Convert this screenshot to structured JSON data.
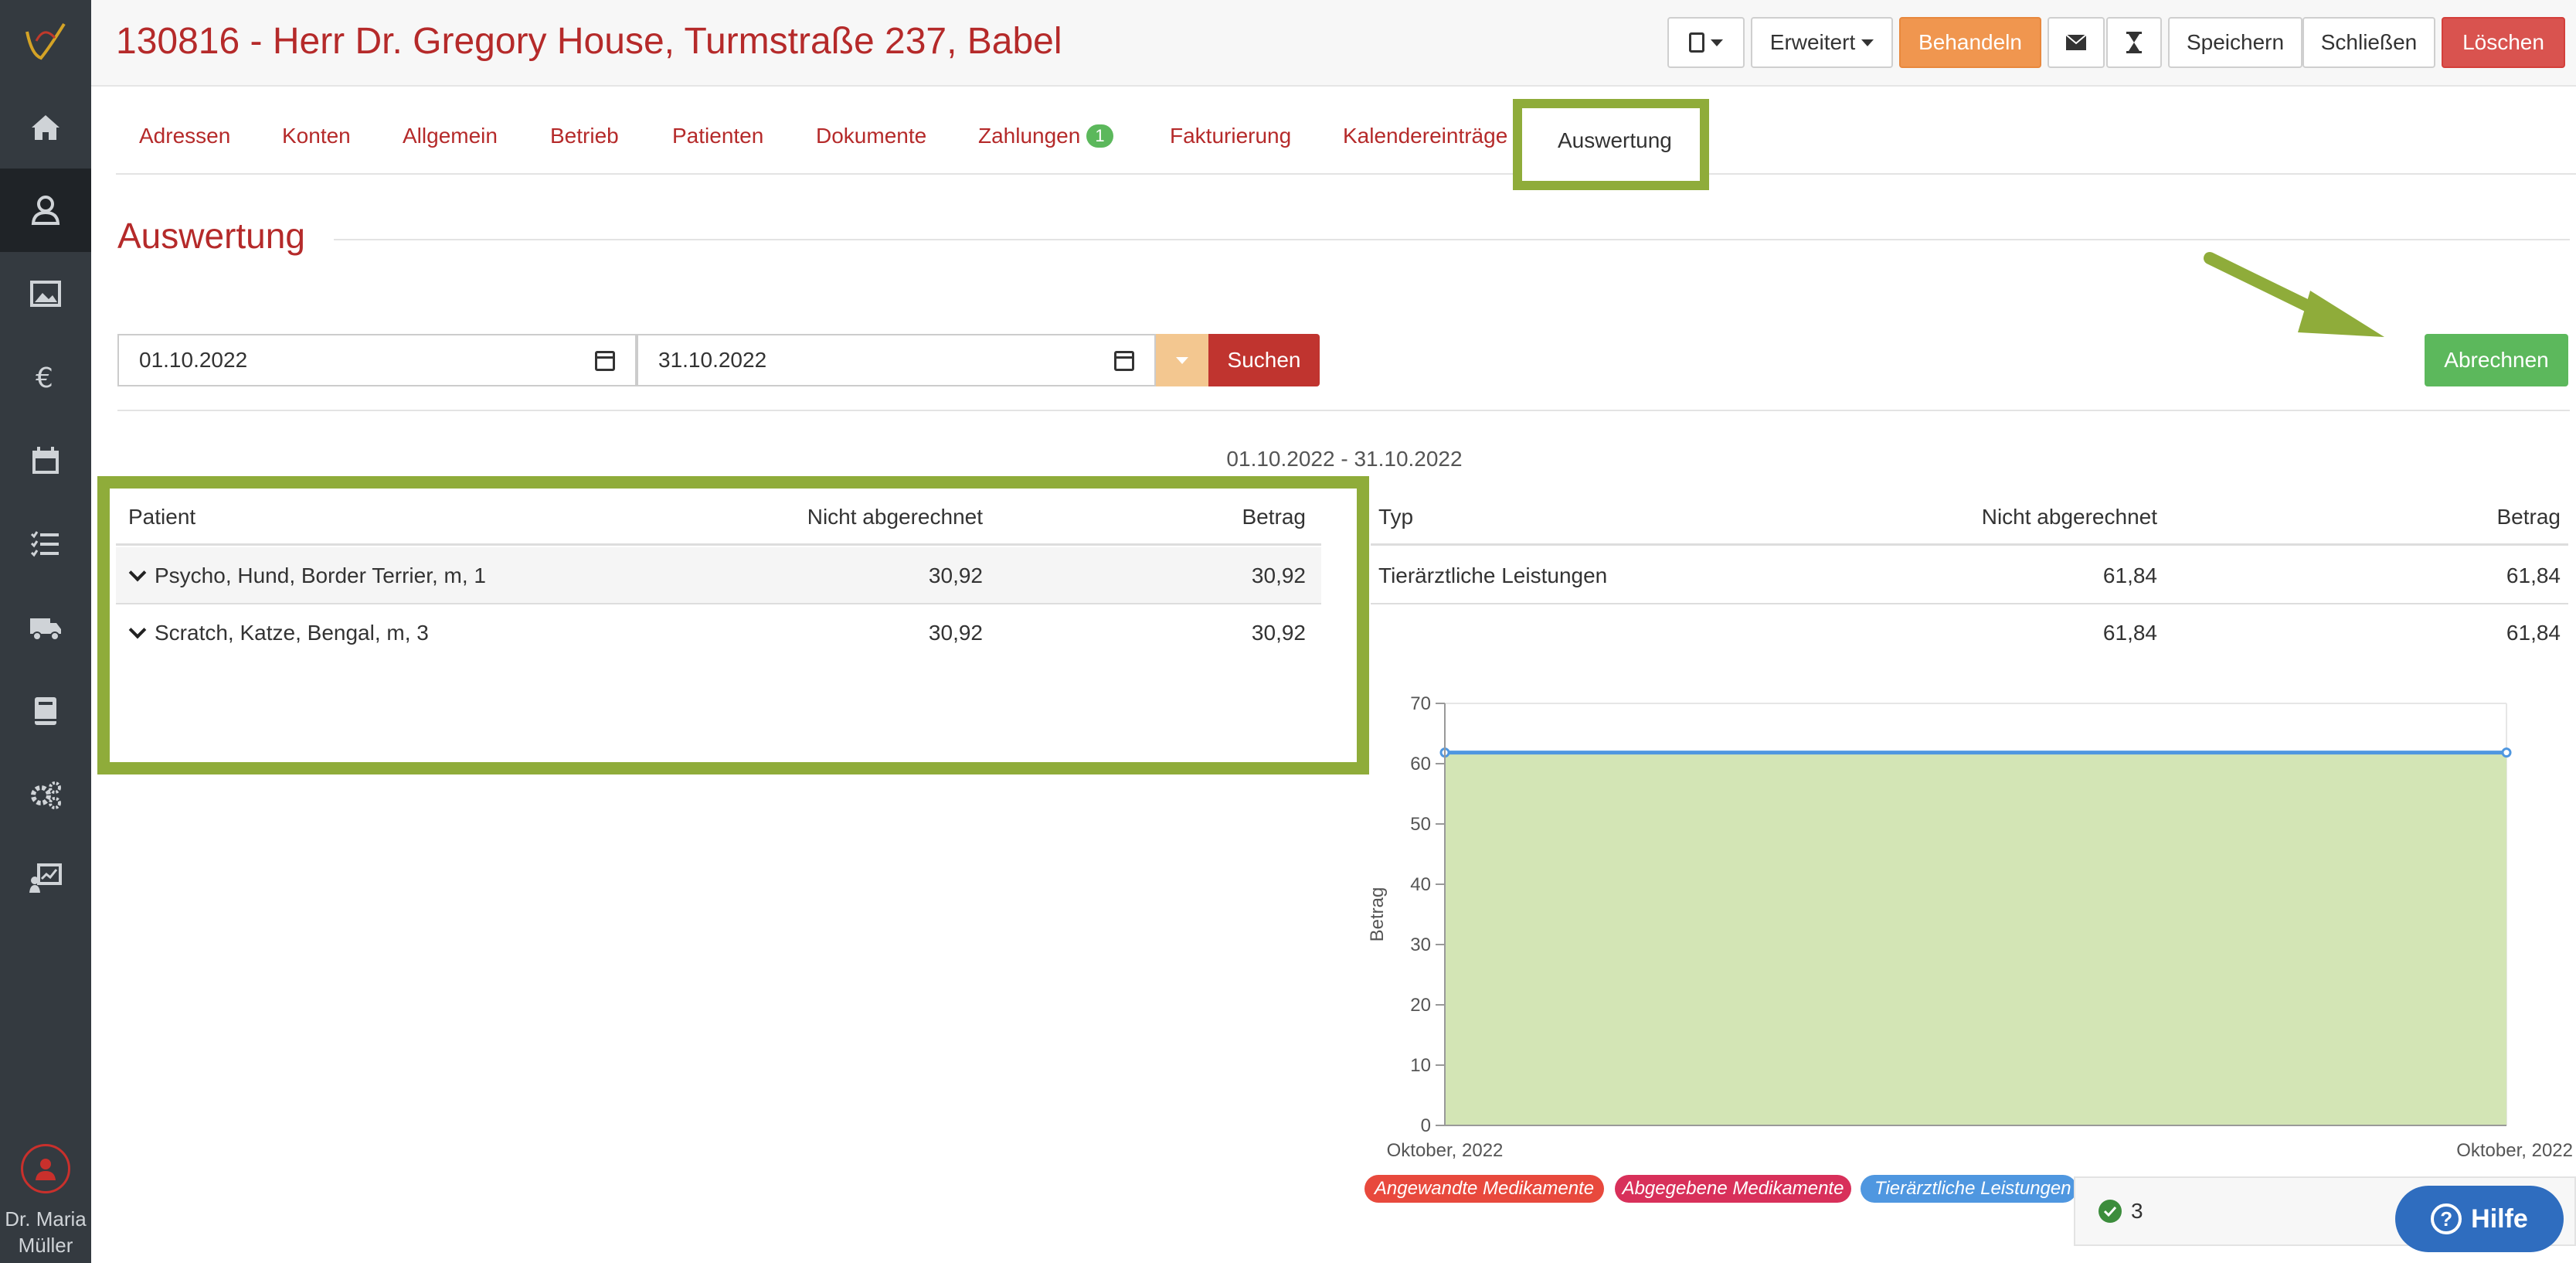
{
  "header": {
    "title": "130816 - Herr Dr. Gregory House, Turmstraße 237, Babel",
    "device_icon": "tablet-icon",
    "erweitert_label": "Erweitert",
    "behandeln_label": "Behandeln",
    "mail_icon": "envelope-icon",
    "timer_icon": "hourglass-icon",
    "speichern_label": "Speichern",
    "schliessen_label": "Schließen",
    "loeschen_label": "Löschen"
  },
  "sidebar": {
    "items": [
      "home-icon",
      "customer-icon",
      "image-icon",
      "euro-icon",
      "calendar-icon",
      "tasks-icon",
      "truck-icon",
      "book-icon",
      "settings-icon",
      "reports-icon"
    ],
    "user_name_line1": "Dr. Maria",
    "user_name_line2": "Müller"
  },
  "tabs": {
    "items": [
      "Adressen",
      "Konten",
      "Allgemein",
      "Betrieb",
      "Patienten",
      "Dokumente",
      "Zahlungen",
      "Fakturierung",
      "Kalendereinträge",
      "Auswertung"
    ],
    "zahlungen_badge": "1",
    "active": "Auswertung"
  },
  "section": {
    "title": "Auswertung",
    "date_from": "01.10.2022",
    "date_to": "31.10.2022",
    "search_label": "Suchen",
    "abrechnen_label": "Abrechnen",
    "range_label": "01.10.2022 - 31.10.2022"
  },
  "patient_table": {
    "headers": [
      "Patient",
      "Nicht abgerechnet",
      "Betrag"
    ],
    "rows": [
      {
        "patient": "Psycho, Hund, Border Terrier, m, 1",
        "nicht_abgerechnet": "30,92",
        "betrag": "30,92"
      },
      {
        "patient": "Scratch, Katze, Bengal, m, 3",
        "nicht_abgerechnet": "30,92",
        "betrag": "30,92"
      }
    ]
  },
  "type_table": {
    "headers": [
      "Typ",
      "Nicht abgerechnet",
      "Betrag"
    ],
    "rows": [
      {
        "typ": "Tierärztliche Leistungen",
        "nicht_abgerechnet": "61,84",
        "betrag": "61,84"
      },
      {
        "typ": "",
        "nicht_abgerechnet": "61,84",
        "betrag": "61,84"
      }
    ]
  },
  "chart_data": {
    "type": "area",
    "x": [
      "Oktober, 2022",
      "Oktober, 2022"
    ],
    "series": [
      {
        "name": "Tierärztliche Leistungen",
        "values": [
          61.84,
          61.84
        ]
      }
    ],
    "ylabel": "Betrag",
    "ylim": [
      0,
      70
    ],
    "yticks": [
      0,
      10,
      20,
      30,
      40,
      50,
      60,
      70
    ],
    "grid": true,
    "legend": [
      "Angewandte Medikamente",
      "Abgegebene Medikamente",
      "Tierärztliche Leistungen"
    ],
    "legend_colors": [
      "#e8493d",
      "#d8305a",
      "#4f97e0"
    ],
    "fill_color": "#d3e5b5",
    "line_color": "#4f97e0"
  },
  "notification": {
    "count": "3"
  },
  "help": {
    "label": "Hilfe"
  },
  "colors": {
    "brand_red": "#b52a2a",
    "highlight_green": "#8fac3a",
    "success_green": "#5cb85c",
    "orange": "#f0964f"
  }
}
